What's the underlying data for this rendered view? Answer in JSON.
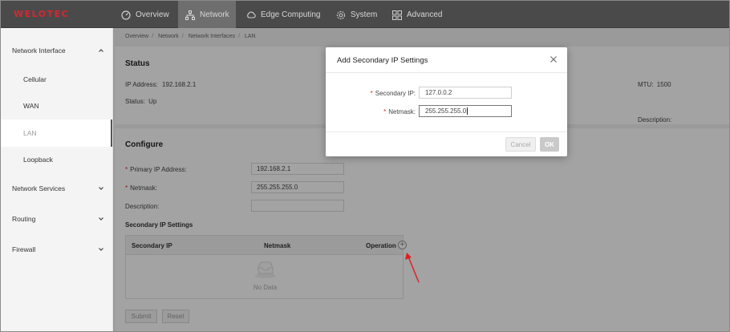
{
  "app": {
    "logo": "WELOTEC"
  },
  "topnav": [
    {
      "label": "Overview",
      "icon": "dashboard-icon"
    },
    {
      "label": "Network",
      "icon": "network-icon",
      "active": true
    },
    {
      "label": "Edge Computing",
      "icon": "edge-computing-icon"
    },
    {
      "label": "System",
      "icon": "gear-icon"
    },
    {
      "label": "Advanced",
      "icon": "grid-icon"
    }
  ],
  "sidebar": {
    "groups": [
      {
        "label": "Network Interface",
        "expanded": true,
        "items": [
          "Cellular",
          "WAN",
          "LAN",
          "Loopback"
        ],
        "active_item": "LAN"
      },
      {
        "label": "Network Services",
        "expanded": false
      },
      {
        "label": "Routing",
        "expanded": false
      },
      {
        "label": "Firewall",
        "expanded": false
      }
    ]
  },
  "breadcrumb": [
    "Overview",
    "Network",
    "Network Interfaces",
    "LAN"
  ],
  "status": {
    "title": "Status",
    "ip_label": "IP Address:",
    "ip_value": "192.168.2.1",
    "status_label": "Status:",
    "status_value": "Up",
    "mtu_label": "MTU:",
    "mtu_value": "1500",
    "description_label": "Description:"
  },
  "configure": {
    "title": "Configure",
    "primary_ip_label": "Primary IP Address:",
    "primary_ip_value": "192.168.2.1",
    "netmask_label": "Netmask:",
    "netmask_value": "255.255.255.0",
    "description_label": "Description:",
    "description_value": "",
    "secondary_title": "Secondary IP Settings",
    "table_headers": [
      "Secondary IP",
      "Netmask",
      "Operation"
    ],
    "no_data": "No Data",
    "submit_label": "Submit",
    "reset_label": "Reset"
  },
  "modal": {
    "title": "Add Secondary IP Settings",
    "secondary_ip_label": "Secondary IP:",
    "secondary_ip_value": "127.0.0.2",
    "netmask_label": "Netmask:",
    "netmask_value": "255.255.255.0",
    "cancel_label": "Cancel",
    "ok_label": "OK"
  },
  "colors": {
    "brand": "#d8262f",
    "topbar": "#4a4a4a",
    "required": "#e02020",
    "annotation_arrow": "#e02020"
  }
}
